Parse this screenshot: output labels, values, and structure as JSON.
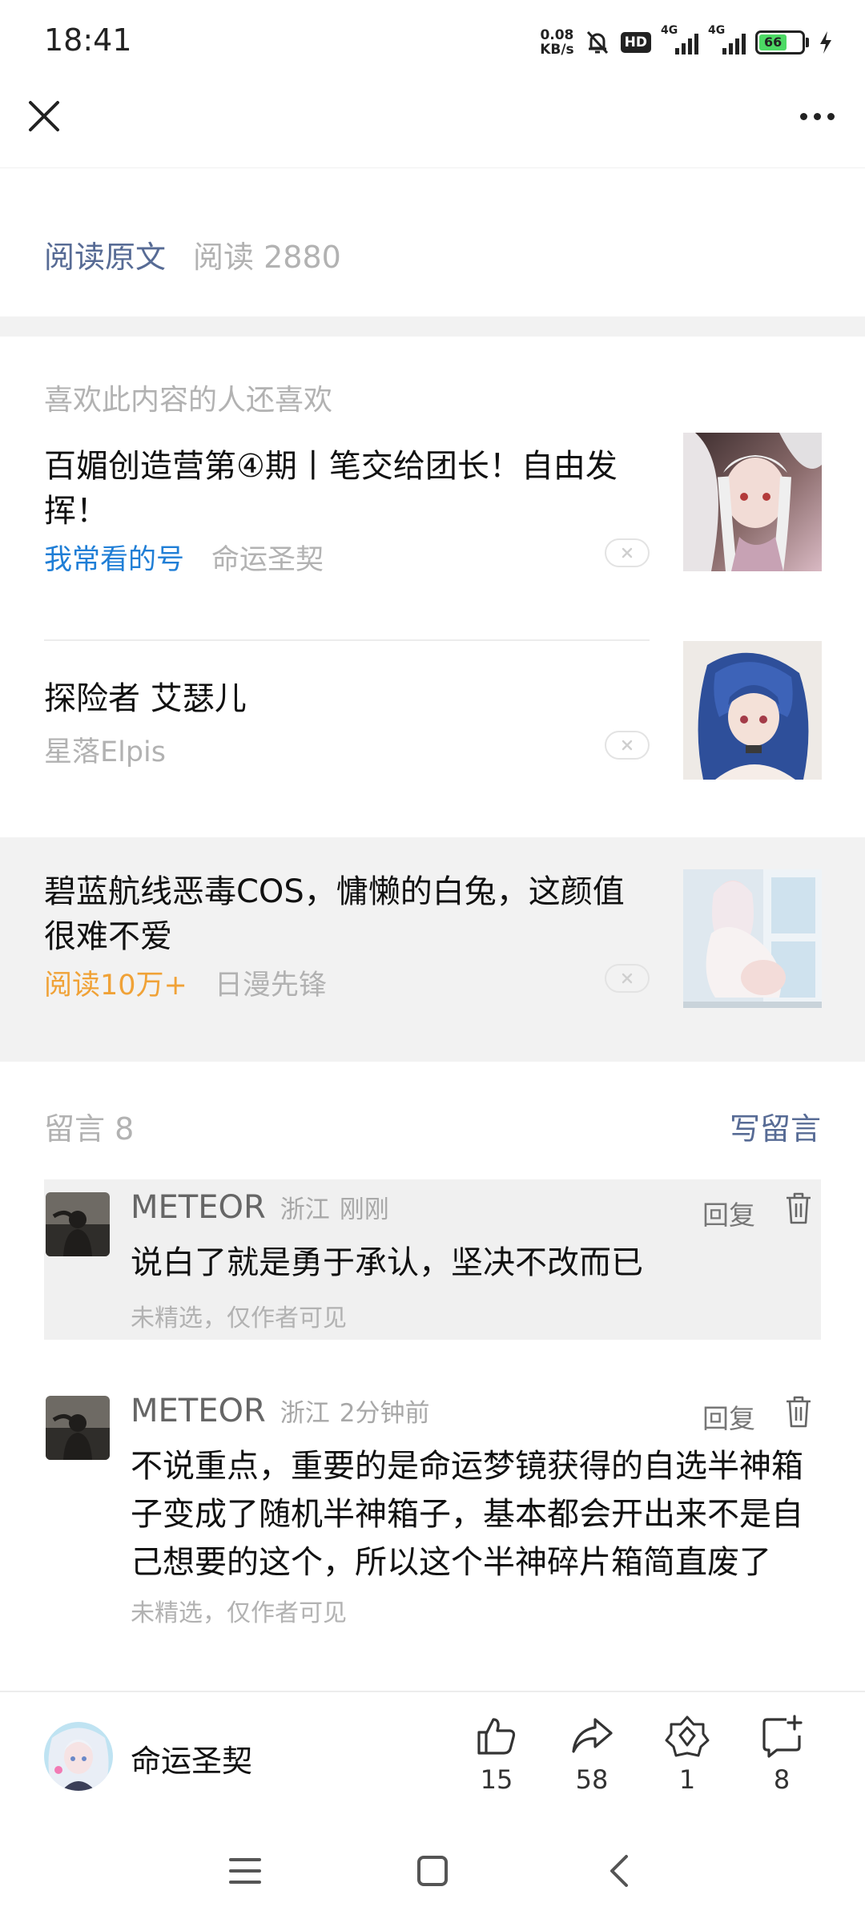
{
  "status_bar": {
    "time": "18:41",
    "net_speed_value": "0.08",
    "net_speed_unit": "KB/s",
    "hd_label": "HD",
    "signal1_label": "4G",
    "signal2_label": "4G",
    "battery_level": "66"
  },
  "read_row": {
    "read_original": "阅读原文",
    "read_count": "阅读 2880"
  },
  "recommendations": {
    "header": "喜欢此内容的人还喜欢",
    "items": [
      {
        "title": "百媚创造营第④期丨笔交给团长！自由发挥！",
        "tag": "我常看的号",
        "source": "命运圣契"
      },
      {
        "title": "探险者 艾瑟儿",
        "tag": "",
        "source": "星落Elpis"
      },
      {
        "title": "碧蓝航线恶毒COS，慵懒的白兔，这颜值很难不爱",
        "tag": "阅读10万+",
        "source": "日漫先锋"
      }
    ]
  },
  "comments": {
    "label": "留言 8",
    "write_label": "写留言",
    "reply_label": "回复",
    "items": [
      {
        "name": "METEOR",
        "location": "浙江",
        "time": "刚刚",
        "text": "说白了就是勇于承认，坚决不改而已",
        "note": "未精选，仅作者可见"
      },
      {
        "name": "METEOR",
        "location": "浙江",
        "time": "2分钟前",
        "text": "不说重点，重要的是命运梦镜获得的自选半神箱子变成了随机半神箱子，基本都会开出来不是自己想要的这个，所以这个半神碎片箱简直废了",
        "note": "未精选，仅作者可见"
      }
    ]
  },
  "bottom_bar": {
    "account_name": "命运圣契",
    "like_count": "15",
    "share_count": "58",
    "star_count": "1",
    "comment_count": "8"
  },
  "colors": {
    "link": "#576b95",
    "tag_blue": "#1f7ed6",
    "tag_orange": "#f0a237",
    "battery": "#4cd964"
  }
}
